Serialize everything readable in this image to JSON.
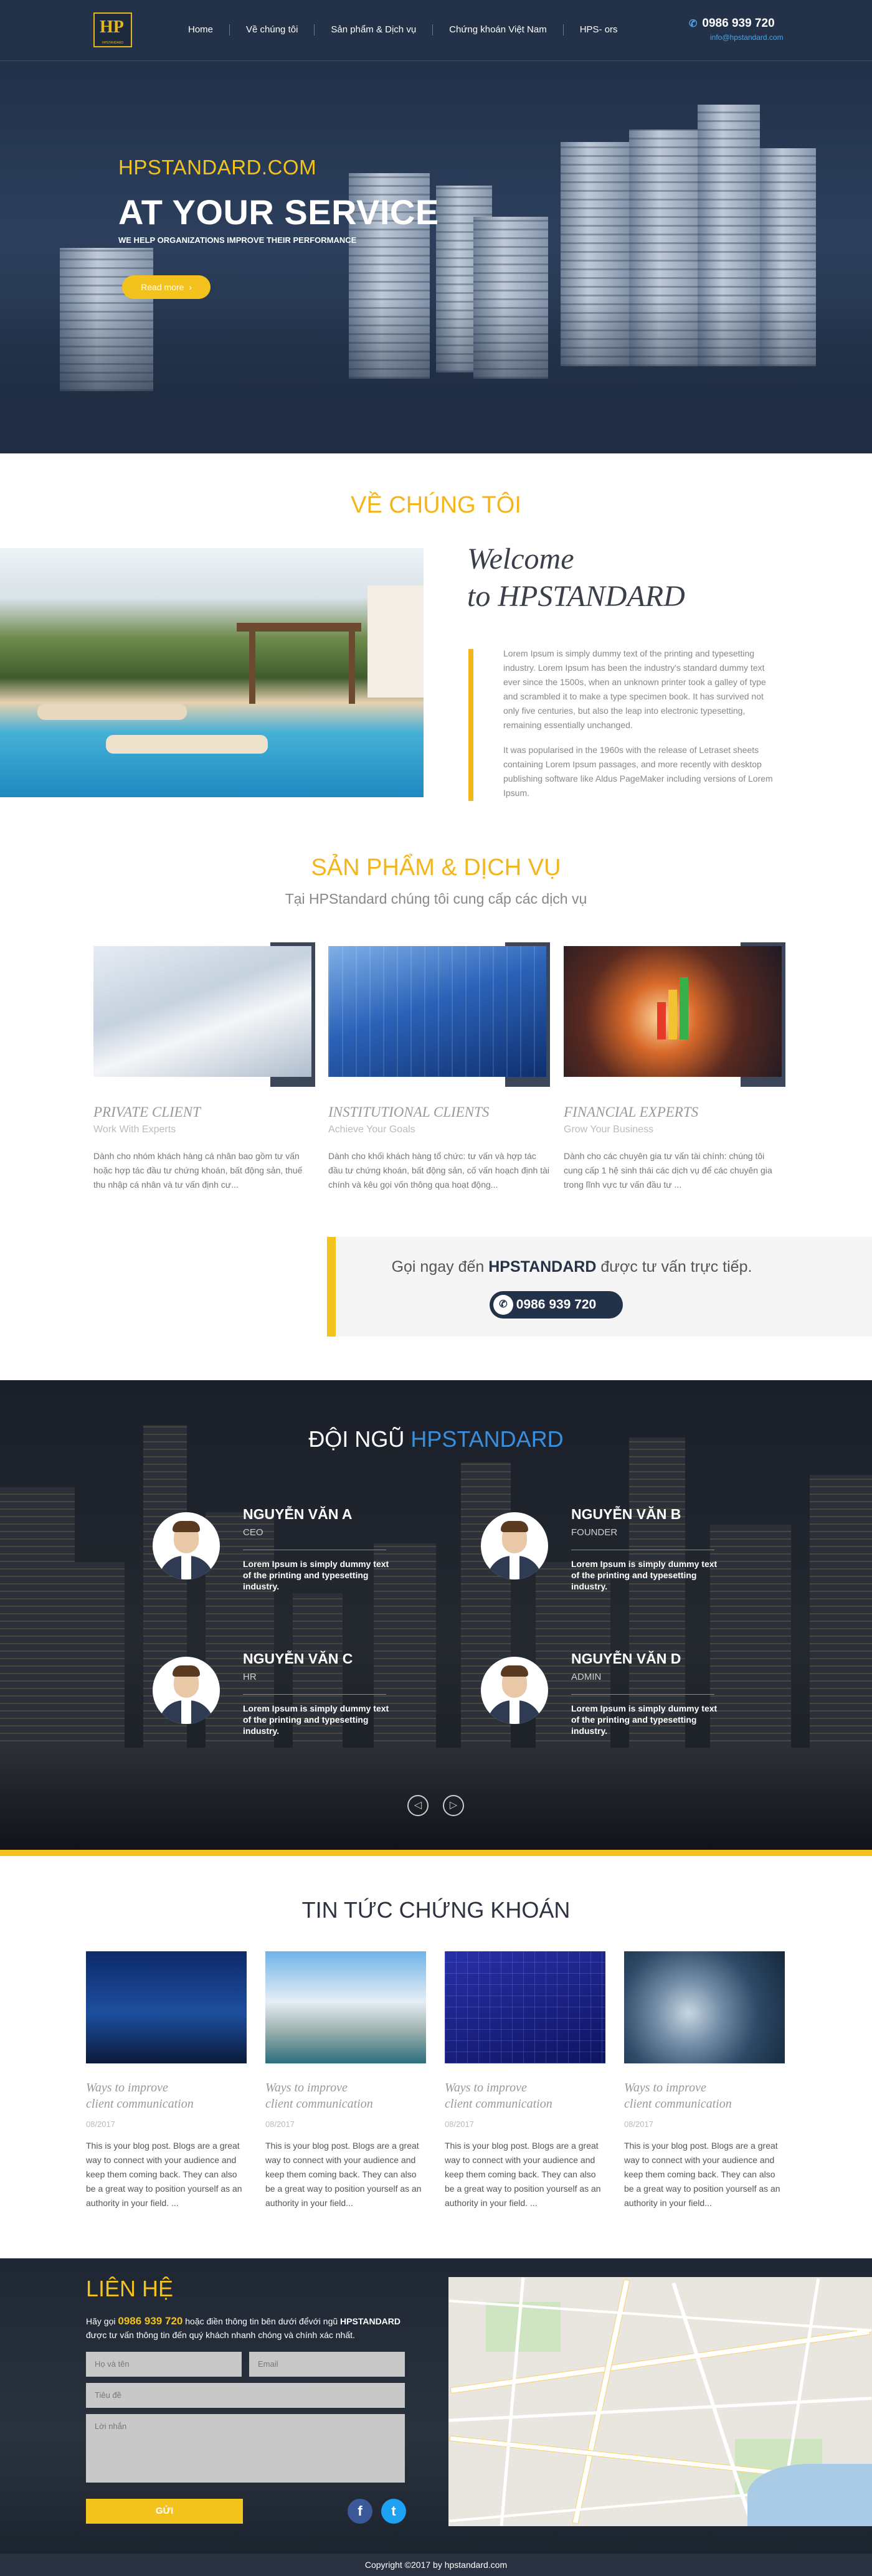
{
  "header": {
    "logo_text": "HP",
    "logo_sub": "HPSTANDARD",
    "nav": [
      "Home",
      "Về chúng tôi",
      "Sản phẩm & Dịch vụ",
      "Chứng khoán Việt Nam",
      "HPS- ors"
    ],
    "phone": "0986 939 720",
    "email": "info@hpstandard.com"
  },
  "hero": {
    "subtitle": "HPSTANDARD.COM",
    "title": "AT YOUR SERVICE",
    "tagline": "WE HELP ORGANIZATIONS IMPROVE THEIR PERFORMANCE",
    "button": "Read more",
    "button_arrow": "›"
  },
  "about": {
    "title": "VỀ CHÚNG TÔI",
    "welcome_1": "Welcome",
    "welcome_2": "to HPSTANDARD",
    "para1": "Lorem Ipsum is simply dummy text of the printing and typesetting industry. Lorem Ipsum has been the industry's standard dummy text ever since the 1500s, when an unknown printer took a galley of type and scrambled it to make a type specimen book. It has survived not only five centuries, but also the leap into electronic typesetting, remaining essentially unchanged.",
    "para2": "It was popularised in the 1960s with the release of Letraset sheets containing Lorem Ipsum passages, and more recently with desktop publishing software like Aldus PageMaker including versions of Lorem Ipsum."
  },
  "services": {
    "title": "SẢN PHẨM & DỊCH VỤ",
    "subtitle": "Tại HPStandard chúng tôi cung cấp các dịch vụ",
    "items": [
      {
        "title": "PRIVATE CLIENT",
        "sub": "Work With Experts",
        "desc": "Dành cho nhóm khách hàng cá nhân bao gồm tư vấn hoặc hợp tác đầu tư chứng khoán, bất động sản, thuế thu nhập cá nhân và tư vấn định cư..."
      },
      {
        "title": "INSTITUTIONAL CLIENTS",
        "sub": "Achieve Your Goals",
        "desc": "Dành cho khối khách hàng tổ chức: tư vấn và hợp tác đầu tư chứng khoán, bất động sản, cố vấn hoạch định tài chính và kêu gọi vốn thông qua hoạt động..."
      },
      {
        "title": "FINANCIAL EXPERTS",
        "sub": "Grow Your Business",
        "desc": "Dành cho các chuyên gia tư vấn tài chính: chúng tôi cung cấp 1 hệ sinh thái các dịch vụ để các chuyên gia trong lĩnh vực tư vấn đầu tư ..."
      }
    ]
  },
  "cta": {
    "text_pre": "Gọi ngay đến ",
    "brand": "HPSTANDARD",
    "text_post": " được tư vấn trực tiếp.",
    "phone": "0986 939 720",
    "phone_icon": "✆"
  },
  "team": {
    "title_1": "ĐỘI NGŨ ",
    "title_2": "HPSTANDARD",
    "members": [
      {
        "name": "NGUYỄN VĂN A",
        "role": "CEO",
        "text": "Lorem Ipsum is simply dummy text of the printing and typesetting industry."
      },
      {
        "name": "NGUYỄN VĂN B",
        "role": "FOUNDER",
        "text": "Lorem Ipsum is simply dummy text of the printing and typesetting industry."
      },
      {
        "name": "NGUYỄN VĂN C",
        "role": "HR",
        "text": "Lorem Ipsum is simply dummy text of the printing and typesetting industry."
      },
      {
        "name": "NGUYỄN VĂN D",
        "role": "ADMIN",
        "text": "Lorem Ipsum is simply dummy text of the printing and typesetting industry."
      }
    ],
    "prev": "◁",
    "next": "▷"
  },
  "news": {
    "title": "TIN TỨC CHỨNG KHOÁN",
    "items": [
      {
        "h1": "Ways to improve",
        "h2": "client communication",
        "date": "08/2017",
        "text": "This is your blog post. Blogs are a great way to connect with your audience and keep them coming back. They can also be a great way to position yourself as an authority in your field. ..."
      },
      {
        "h1": "Ways to improve",
        "h2": "client communication",
        "date": "08/2017",
        "text": "This is your blog post. Blogs are a great way to connect with your audience and keep them coming back. They can also be a great way to position yourself as an authority in your field..."
      },
      {
        "h1": "Ways to improve",
        "h2": "client communication",
        "date": "08/2017",
        "text": "This is your blog post. Blogs are a great way to connect with your audience and keep them coming back. They can also be a great way to position yourself as an authority in your field. ..."
      },
      {
        "h1": "Ways to improve",
        "h2": "client communication",
        "date": "08/2017",
        "text": "This is your blog post. Blogs are a great way to connect with your audience and keep them coming back. They can also be a great way to position yourself as an authority in your field..."
      }
    ]
  },
  "contact": {
    "title": "LIÊN HỆ",
    "text_1": "Hãy gọi ",
    "phone": "0986 939 720",
    "text_2": " hoặc điền thông tin  bên dưới đểvới ngũ ",
    "brand": "HPSTANDARD",
    "text_3": " được tư vấn thông tin đến quý khách nhanh chóng và chính xác nhất.",
    "name_placeholder": "Họ và tên",
    "email_placeholder": "Email",
    "subject_placeholder": "Tiêu đề",
    "message_placeholder": "Lời nhắn",
    "send": "GỬI",
    "facebook": "f",
    "twitter": "t"
  },
  "footer": {
    "copyright": "Copyright ©2017 by hpstandard.com"
  },
  "colors": {
    "accent": "#f4c21c",
    "navy": "#233249",
    "blue": "#3a8fdc"
  }
}
